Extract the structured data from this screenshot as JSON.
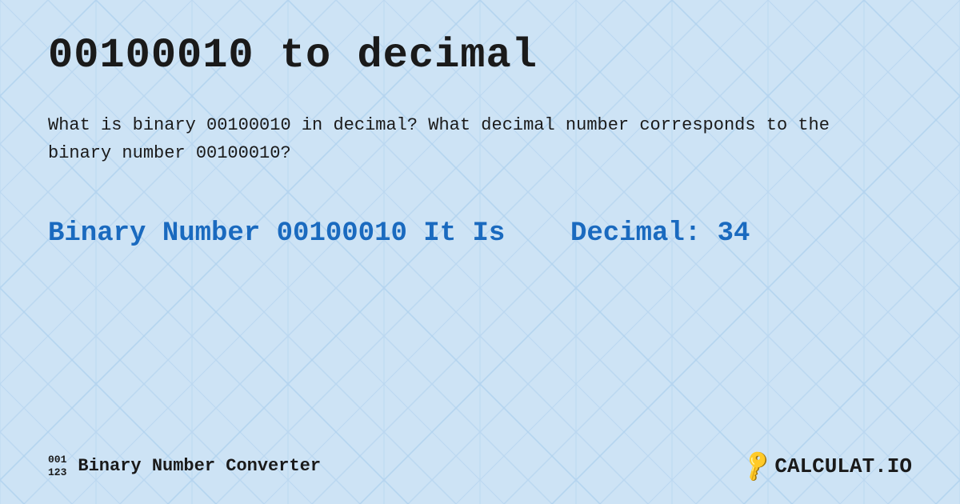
{
  "page": {
    "title": "00100010 to decimal",
    "description_part1": "What is binary 00100010 in decimal?",
    "description_part2": "What decimal number corresponds to the binary number 00100010?",
    "result_label": "Binary Number",
    "result_binary": "00100010",
    "result_middle": "It Is",
    "result_decimal_label": "Decimal:",
    "result_decimal_value": "34"
  },
  "footer": {
    "logo_line1": "001",
    "logo_line2": "123",
    "app_name": "Binary Number Converter",
    "brand": "CALCULAT.IO"
  },
  "colors": {
    "background": "#cde3f5",
    "title_color": "#1a1a1a",
    "result_color": "#1a6abf",
    "text_color": "#1a1a1a"
  }
}
